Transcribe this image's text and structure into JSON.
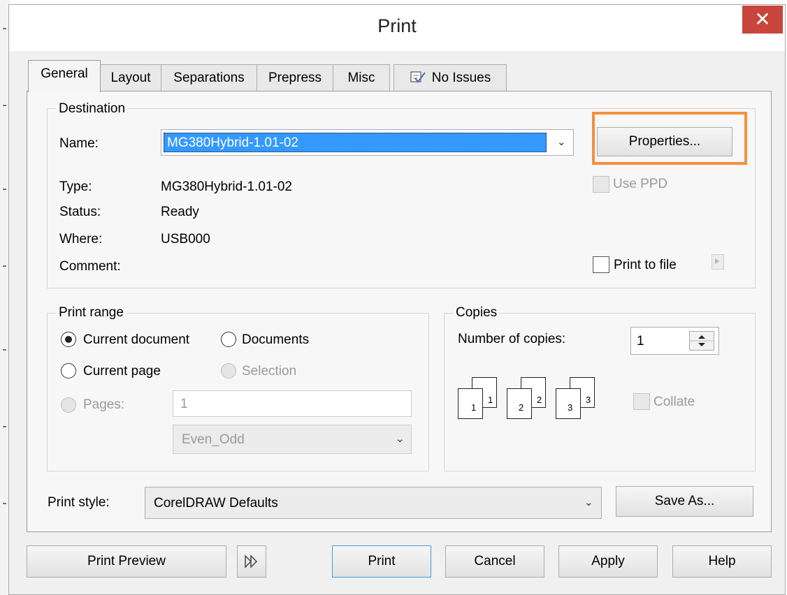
{
  "window": {
    "title": "Print",
    "close_glyph": "✕"
  },
  "tabs": [
    {
      "label": "General",
      "active": true
    },
    {
      "label": "Layout"
    },
    {
      "label": "Separations"
    },
    {
      "label": "Prepress"
    },
    {
      "label": "Misc"
    },
    {
      "label": "No Issues",
      "icon": "checklist-icon"
    }
  ],
  "destination": {
    "legend": "Destination",
    "name_label": "Name:",
    "name_value": "MG380Hybrid-1.01-02",
    "properties_button": "Properties...",
    "use_ppd_label": "Use PPD",
    "type_label": "Type:",
    "type_value": "MG380Hybrid-1.01-02",
    "status_label": "Status:",
    "status_value": "Ready",
    "where_label": "Where:",
    "where_value": "USB000",
    "comment_label": "Comment:",
    "print_to_file_label": "Print to file"
  },
  "print_range": {
    "legend": "Print range",
    "current_document": "Current document",
    "documents": "Documents",
    "current_page": "Current page",
    "selection": "Selection",
    "pages_label": "Pages:",
    "pages_value": "1",
    "even_odd_value": "Even_Odd"
  },
  "copies": {
    "legend": "Copies",
    "number_label": "Number of copies:",
    "number_value": "1",
    "collate_label": "Collate",
    "sheet_numbers": [
      "1",
      "1",
      "2",
      "2",
      "3",
      "3"
    ]
  },
  "print_style": {
    "label": "Print style:",
    "value": "CorelDRAW Defaults",
    "save_as_button": "Save As..."
  },
  "bottom_buttons": {
    "print_preview": "Print Preview",
    "print": "Print",
    "cancel": "Cancel",
    "apply": "Apply",
    "help": "Help"
  },
  "colors": {
    "highlight": "#f2913d",
    "selection": "#3399ff",
    "close": "#c7453b"
  }
}
